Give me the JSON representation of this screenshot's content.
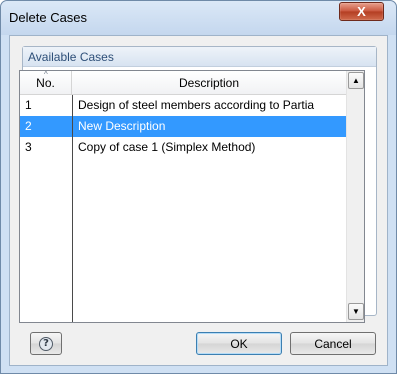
{
  "dialog": {
    "title": "Delete Cases",
    "close_glyph": "X"
  },
  "group": {
    "title": "Available Cases"
  },
  "table": {
    "columns": [
      "No.",
      "Description"
    ],
    "rows": [
      {
        "no": "1",
        "description": "Design of steel members according to Partia",
        "selected": false
      },
      {
        "no": "2",
        "description": "New Description",
        "selected": true
      },
      {
        "no": "3",
        "description": "Copy of case 1 (Simplex Method)",
        "selected": false
      }
    ],
    "sort_indicator": "^"
  },
  "scrollbar": {
    "up_glyph": "▲",
    "down_glyph": "▼"
  },
  "buttons": {
    "help_icon": "?",
    "ok_label": "OK",
    "cancel_label": "Cancel"
  },
  "colors": {
    "selection": "#3399ff",
    "window_frame": "#cfe0f3"
  }
}
